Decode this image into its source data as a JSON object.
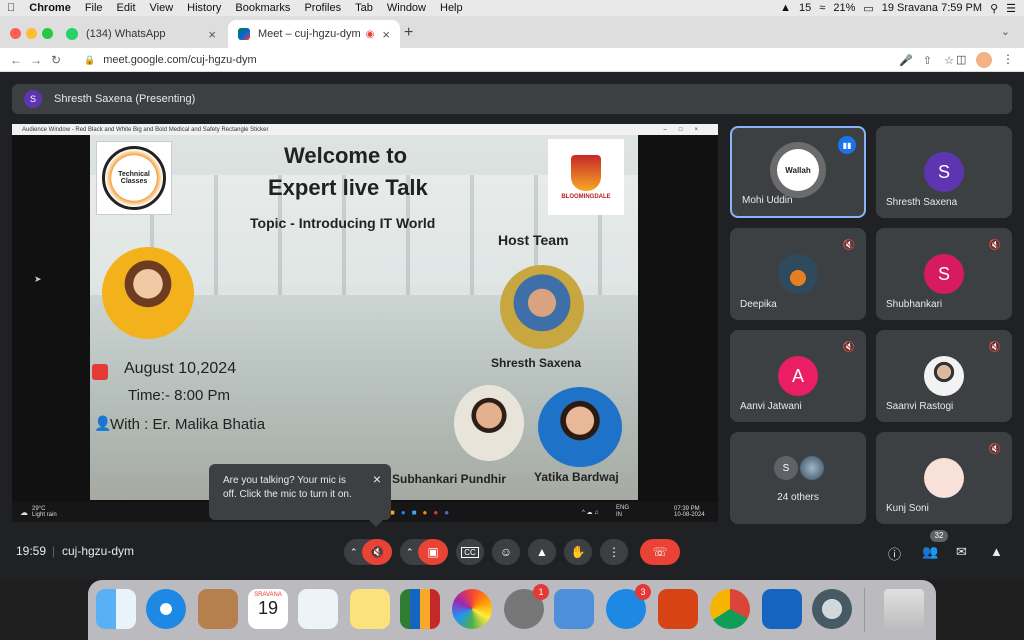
{
  "menubar": {
    "app": "Chrome",
    "items": [
      "File",
      "Edit",
      "View",
      "History",
      "Bookmarks",
      "Profiles",
      "Tab",
      "Window",
      "Help"
    ],
    "status_count": "15",
    "battery": "21%",
    "date_time": "19 Sravana  7:59 PM"
  },
  "tabs": [
    {
      "label": "(134) WhatsApp",
      "active": false
    },
    {
      "label": "Meet – cuj-hgzu-dym",
      "active": true
    }
  ],
  "address": {
    "url": "meet.google.com/cuj-hgzu-dym"
  },
  "presenter": {
    "initial": "S",
    "label": "Shresth Saxena (Presenting)"
  },
  "share_window": {
    "title": "Audience Window - Red Black and White Big and Bold Medical and Safety Rectangle Sticker",
    "slide": {
      "logo_left": "Technical Classes",
      "logo_right": "BLOOMINGDALE",
      "title_line1": "Welcome to",
      "title_line2": "Expert live Talk",
      "topic": "Topic - Introducing IT World",
      "host_team": "Host Team",
      "host_name": "Shresth Saxena",
      "date": "August 10,2024",
      "time": "Time:- 8:00 Pm",
      "with": "With : Er. Malika Bhatia",
      "member1": "Subhankari Pundhir",
      "member2": "Yatika Bardwaj"
    },
    "taskbar": {
      "weather_temp": "29°C",
      "weather_desc": "Light rain",
      "lang": "ENG IN",
      "clock_time": "07:39 PM",
      "clock_date": "10-08-2024"
    }
  },
  "participants": [
    {
      "name": "Mohi Uddin",
      "avatar_text": "Wallah",
      "speaking": true
    },
    {
      "name": "Shresth Saxena",
      "initial": "S",
      "color": "#5e35b1"
    },
    {
      "name": "Deepika",
      "muted": true
    },
    {
      "name": "Shubhankari",
      "initial": "S",
      "color": "#d81b60",
      "muted": true
    },
    {
      "name": "Aanvi Jatwani",
      "initial": "A",
      "color": "#e91e63",
      "muted": true
    },
    {
      "name": "Saanvi Rastogi",
      "muted": true
    },
    {
      "name": "24 others",
      "initial": "S"
    },
    {
      "name": "Kunj Soni",
      "muted": true
    }
  ],
  "tooltip": {
    "text": "Are you talking? Your mic is off. Click the mic to turn it on."
  },
  "controls": {
    "time": "19:59",
    "meeting_code": "cuj-hgzu-dym",
    "people_count": "32"
  },
  "dock": {
    "calendar_month": "SRAVANA",
    "calendar_day": "19",
    "settings_badge": "1",
    "appstore_badge": "3"
  },
  "colors": {
    "meet_bg": "#202124",
    "tile_bg": "#3c4043",
    "end_call": "#ea4335",
    "mic_off": "#ea4335"
  }
}
